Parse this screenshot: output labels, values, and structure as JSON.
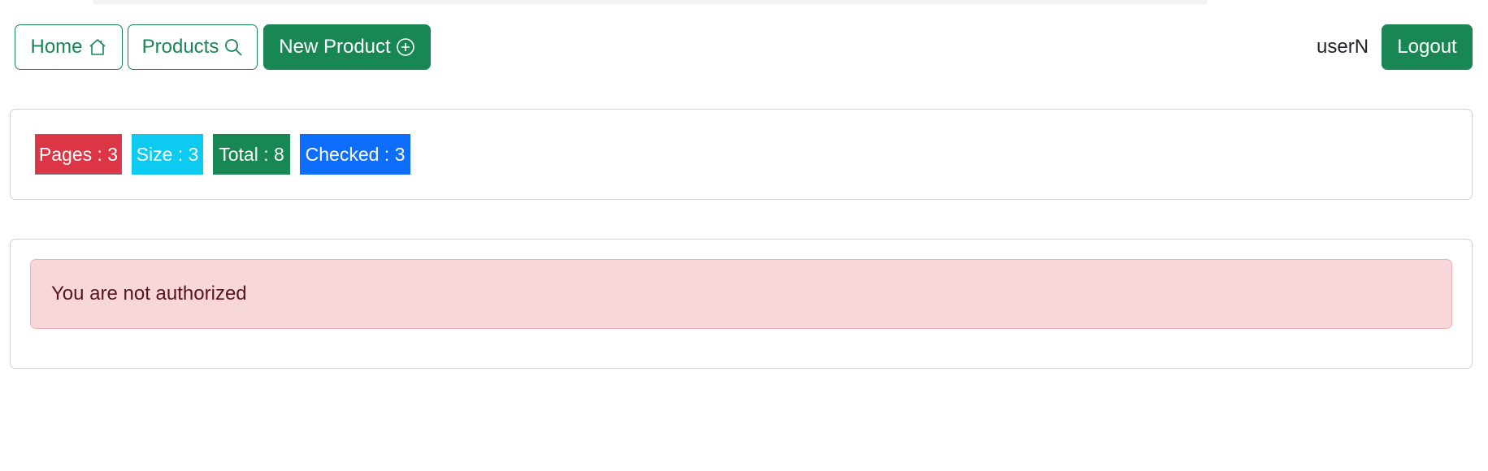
{
  "nav": {
    "home_label": "Home",
    "products_label": "Products",
    "new_product_label": "New Product",
    "username": "userN",
    "logout_label": "Logout"
  },
  "stats": {
    "pages": "Pages : 3",
    "size": "Size : 3",
    "total": "Total : 8",
    "checked": "Checked : 3"
  },
  "alert": {
    "message": "You are not authorized"
  },
  "icons": {
    "home": "house-icon",
    "products": "search-icon",
    "new_product": "plus-circle-icon"
  },
  "colors": {
    "primary_green": "#198754",
    "pages_badge": "#dc3545",
    "size_badge": "#0dcaf0",
    "total_badge": "#198754",
    "checked_badge": "#0d6efd",
    "alert_bg": "#f8d7da",
    "alert_text": "#58151c"
  }
}
